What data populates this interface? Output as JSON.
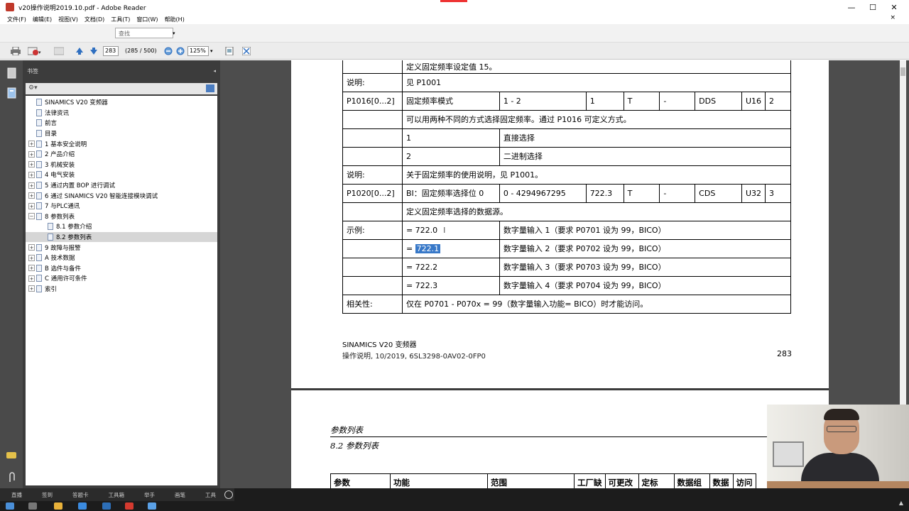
{
  "window": {
    "title": "v20操作说明2019.10.pdf - Adobe Reader",
    "minimize": "—",
    "maximize": "☐",
    "close": "✕"
  },
  "menu": {
    "items": [
      "文件(F)",
      "编辑(E)",
      "视图(V)",
      "文档(D)",
      "工具(T)",
      "窗口(W)",
      "帮助(H)"
    ],
    "close": "×"
  },
  "find": {
    "placeholder": "查找"
  },
  "toolbar": {
    "page_current": "283",
    "page_count": "(285 / 500)",
    "zoom": "125%"
  },
  "bookmarks": {
    "panel_title": "书签",
    "items": [
      {
        "label": "SINAMICS V20 变频器",
        "expand": "",
        "indent": 0,
        "selected": false
      },
      {
        "label": "法律资讯",
        "expand": "",
        "indent": 0,
        "selected": false
      },
      {
        "label": "前言",
        "expand": "",
        "indent": 0,
        "selected": false
      },
      {
        "label": "目录",
        "expand": "",
        "indent": 0,
        "selected": false
      },
      {
        "label": "1  基本安全说明",
        "expand": "+",
        "indent": 0,
        "selected": false
      },
      {
        "label": "2  产品介绍",
        "expand": "+",
        "indent": 0,
        "selected": false
      },
      {
        "label": "3  机械安装",
        "expand": "+",
        "indent": 0,
        "selected": false
      },
      {
        "label": "4  电气安装",
        "expand": "+",
        "indent": 0,
        "selected": false
      },
      {
        "label": "5  通过内置 BOP 进行调试",
        "expand": "+",
        "indent": 0,
        "selected": false
      },
      {
        "label": "6  通过 SINAMICS V20 智能连接模块调试",
        "expand": "+",
        "indent": 0,
        "selected": false
      },
      {
        "label": "7  与PLC通讯",
        "expand": "+",
        "indent": 0,
        "selected": false
      },
      {
        "label": "8  参数列表",
        "expand": "−",
        "indent": 0,
        "selected": false
      },
      {
        "label": "8.1  参数介绍",
        "expand": "",
        "indent": 1,
        "selected": false
      },
      {
        "label": "8.2  参数列表",
        "expand": "",
        "indent": 1,
        "selected": true
      },
      {
        "label": "9  故障与报警",
        "expand": "+",
        "indent": 0,
        "selected": false
      },
      {
        "label": "A  技术数据",
        "expand": "+",
        "indent": 0,
        "selected": false
      },
      {
        "label": "B  选件与备件",
        "expand": "+",
        "indent": 0,
        "selected": false
      },
      {
        "label": "C  通用许可条件",
        "expand": "+",
        "indent": 0,
        "selected": false
      },
      {
        "label": "索引",
        "expand": "+",
        "indent": 0,
        "selected": false
      }
    ]
  },
  "page283": {
    "top_text": "定义固定频率设定值 15。",
    "r_note1_label": "说明:",
    "r_note1_text": "见 P1001",
    "p1016": {
      "param": "P1016[0...2]",
      "func": "固定频率模式",
      "range": "1 - 2",
      "default": "1",
      "change": "T",
      "unit": "-",
      "group": "DDS",
      "dtype": "U16",
      "access": "2"
    },
    "p1016_desc": "可以用两种不同的方式选择固定频率。通过 P1016 可定义方式。",
    "opt1_val": "1",
    "opt1_text": "直接选择",
    "opt2_val": "2",
    "opt2_text": "二进制选择",
    "r_note2_label": "说明:",
    "r_note2_text": "关于固定频率的使用说明，见 P1001。",
    "p1020": {
      "param": "P1020[0...2]",
      "func": "BI：固定频率选择位 0",
      "range": "0 - 4294967295",
      "default": "722.3",
      "change": "T",
      "unit": "-",
      "group": "CDS",
      "dtype": "U32",
      "access": "3"
    },
    "p1020_desc": "定义固定频率选择的数据源。",
    "example_label": "示例:",
    "examples": [
      {
        "val": "= 722.0",
        "text": "数字量输入 1（要求 P0701 设为 99，BICO）"
      },
      {
        "val_prefix": "= ",
        "val_hl": "722.1",
        "text": "数字量输入 2（要求 P0702 设为 99，BICO）"
      },
      {
        "val": "= 722.2",
        "text": "数字量输入 3（要求 P0703 设为 99，BICO）"
      },
      {
        "val": "= 722.3",
        "text": "数字量输入 4（要求 P0704 设为 99，BICO）"
      }
    ],
    "dep_label": "相关性:",
    "dep_text": "仅在 P0701 - P070x = 99（数字量输入功能= BICO）时才能访问。",
    "footer_line1": "SINAMICS V20 变频器",
    "footer_line2": "操作说明, 10/2019, 6SL3298-0AV02-0FP0",
    "page_number": "283"
  },
  "page284": {
    "header1": "参数列表",
    "header2": "8.2 参数列表",
    "columns": [
      "参数",
      "功能",
      "范围",
      "工厂缺",
      "可更改",
      "定标",
      "数据组",
      "数据",
      "访问"
    ]
  },
  "taskbar": {
    "tabs": [
      "直播",
      "签到",
      "答题卡",
      "工具箱",
      "举手",
      "画笔",
      "工具"
    ]
  }
}
